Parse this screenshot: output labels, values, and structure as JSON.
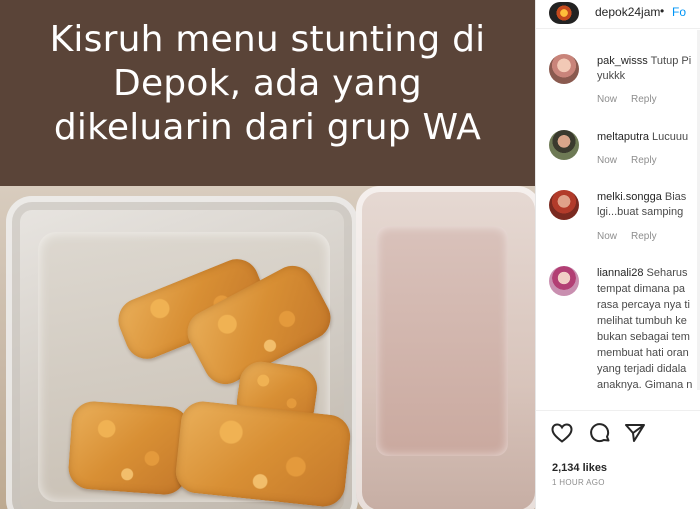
{
  "post": {
    "caption_lines": [
      "Kisruh menu stunting di",
      "Depok, ada yang",
      "dikeluarin dari grup WA"
    ]
  },
  "header": {
    "username": "depok24jam",
    "separator": "•",
    "follow_label": "Fo"
  },
  "comments": [
    {
      "username": "pak_wisss",
      "lines": [
        "Tutup Pi",
        "yukkk"
      ],
      "time": "Now",
      "reply": "Reply"
    },
    {
      "username": "meltaputra",
      "lines": [
        "Lucuuu"
      ],
      "time": "Now",
      "reply": "Reply"
    },
    {
      "username": "melki.songga",
      "lines": [
        "Bias",
        "lgi...buat samping"
      ],
      "time": "Now",
      "reply": "Reply"
    },
    {
      "username": "liannali28",
      "lines": [
        "Seharus",
        "tempat dimana pa",
        "rasa percaya nya ti",
        "melihat tumbuh ke",
        "bukan sebagai tem",
        "membuat hati oran",
        "yang terjadi didala",
        "anaknya. Gimana n"
      ]
    }
  ],
  "actions": {
    "likes": "2,134 likes",
    "time_ago": "1 HOUR AGO"
  },
  "icons": {
    "like": "heart-icon",
    "comment": "comment-bubble-icon",
    "share": "paper-plane-icon"
  },
  "colors": {
    "link": "#0095f6",
    "caption_bg": "#5a4438"
  }
}
